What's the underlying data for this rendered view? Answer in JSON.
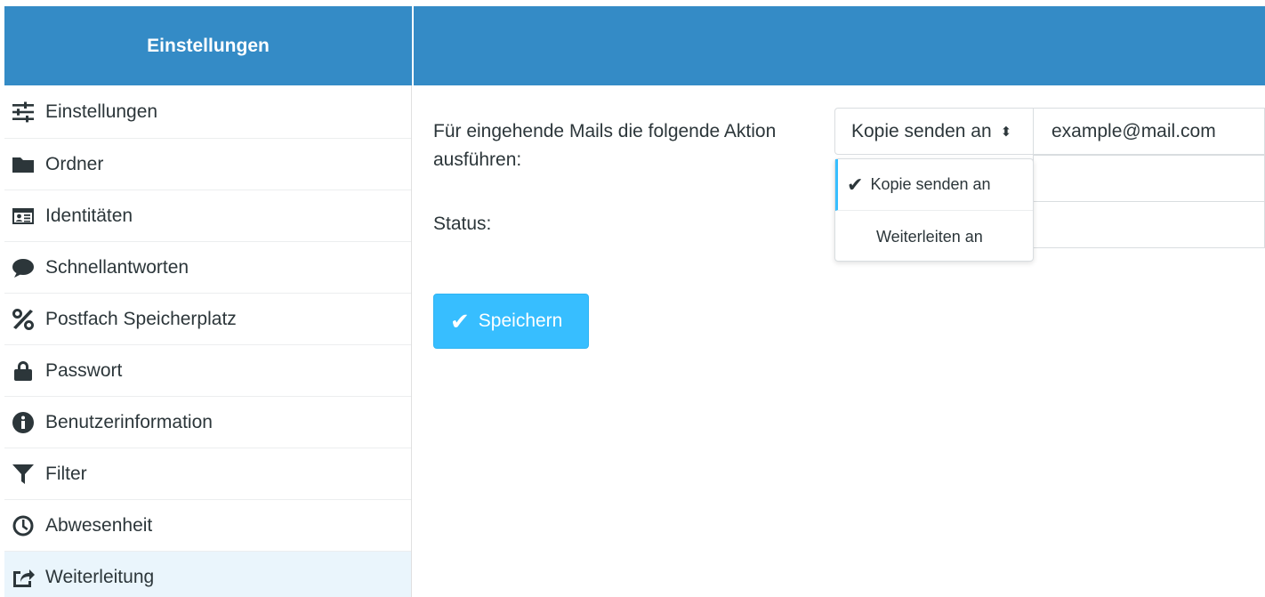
{
  "header": {
    "title": "Einstellungen"
  },
  "sidebar": {
    "items": [
      {
        "label": "Einstellungen",
        "icon": "sliders-icon"
      },
      {
        "label": "Ordner",
        "icon": "folder-icon"
      },
      {
        "label": "Identitäten",
        "icon": "id-card-icon"
      },
      {
        "label": "Schnellantworten",
        "icon": "speech-bubble-icon"
      },
      {
        "label": "Postfach Speicherplatz",
        "icon": "percent-icon"
      },
      {
        "label": "Passwort",
        "icon": "lock-icon"
      },
      {
        "label": "Benutzerinformation",
        "icon": "info-icon"
      },
      {
        "label": "Filter",
        "icon": "filter-icon"
      },
      {
        "label": "Abwesenheit",
        "icon": "clock-icon"
      },
      {
        "label": "Weiterleitung",
        "icon": "share-icon"
      }
    ],
    "selected": "Weiterleitung"
  },
  "form": {
    "action_label": "Für eingehende Mails die folgende Aktion ausführen:",
    "status_label": "Status:",
    "action_select_value": "Kopie senden an",
    "email_value": "example@mail.com",
    "dropdown_options": [
      "Kopie senden an",
      "Weiterleiten an"
    ],
    "save_label": "Speichern"
  },
  "colors": {
    "header": "#348bc6",
    "accent": "#37beff",
    "selected_bg": "#eaf5fc"
  }
}
